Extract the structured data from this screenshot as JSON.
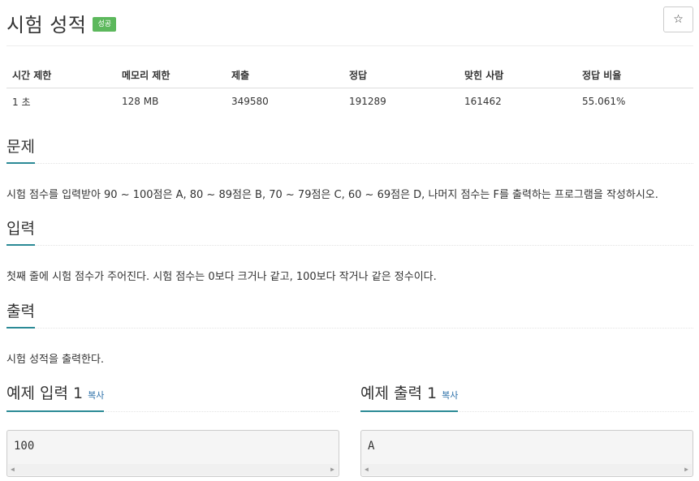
{
  "problem": {
    "title": "시험 성적",
    "badge": "성공",
    "star": "☆"
  },
  "info": {
    "headers": [
      "시간 제한",
      "메모리 제한",
      "제출",
      "정답",
      "맞힌 사람",
      "정답 비율"
    ],
    "values": [
      "1 초",
      "128 MB",
      "349580",
      "191289",
      "161462",
      "55.061%"
    ]
  },
  "sections": {
    "description": {
      "title": "문제",
      "text": "시험 점수를 입력받아 90 ~ 100점은 A, 80 ~ 89점은 B, 70 ~ 79점은 C, 60 ~ 69점은 D, 나머지 점수는 F를 출력하는 프로그램을 작성하시오."
    },
    "input": {
      "title": "입력",
      "text": "첫째 줄에 시험 점수가 주어진다. 시험 점수는 0보다 크거나 같고, 100보다 작거나 같은 정수이다."
    },
    "output": {
      "title": "출력",
      "text": "시험 성적을 출력한다."
    }
  },
  "examples": {
    "input": {
      "title": "예제 입력 1",
      "copy": "복사",
      "code": "100"
    },
    "output": {
      "title": "예제 출력 1",
      "copy": "복사",
      "code": "A"
    }
  },
  "colors": {
    "accent": "#2b8a96",
    "badge": "#5cb85c",
    "link": "#2b6fa8"
  }
}
